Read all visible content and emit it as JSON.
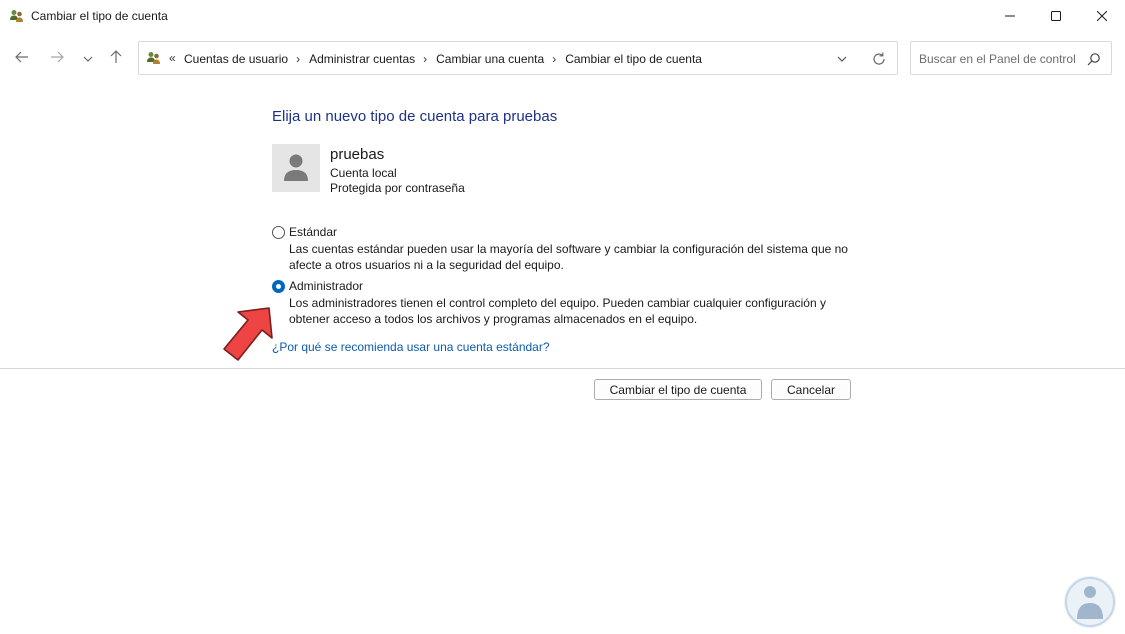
{
  "window": {
    "title": "Cambiar el tipo de cuenta"
  },
  "nav": {
    "breadcrumbs": [
      "Cuentas de usuario",
      "Administrar cuentas",
      "Cambiar una cuenta",
      "Cambiar el tipo de cuenta"
    ],
    "search_placeholder": "Buscar en el Panel de control"
  },
  "main": {
    "heading": "Elija un nuevo tipo de cuenta para pruebas",
    "user": {
      "name": "pruebas",
      "type": "Cuenta local",
      "protection": "Protegida por contraseña"
    },
    "options": [
      {
        "label": "Estándar",
        "description": "Las cuentas estándar pueden usar la mayoría del software y cambiar la configuración del sistema que no afecte a otros usuarios ni a la seguridad del equipo.",
        "selected": false
      },
      {
        "label": "Administrador",
        "description": "Los administradores tienen el control completo del equipo. Pueden cambiar cualquier configuración y obtener acceso a todos los archivos y programas almacenados en el equipo.",
        "selected": true
      }
    ],
    "help_link": "¿Por qué se recomienda usar una cuenta estándar?"
  },
  "footer": {
    "primary_button": "Cambiar el tipo de cuenta",
    "cancel_button": "Cancelar"
  },
  "colors": {
    "heading": "#1e3287",
    "link": "#0b5cad",
    "radio_selected": "#0067c0",
    "annotation_arrow": "#ee4444"
  },
  "icons": [
    "control-panel-icon",
    "minimize-icon",
    "maximize-icon",
    "close-icon",
    "back-arrow-icon",
    "forward-arrow-icon",
    "recent-dropdown-icon",
    "up-arrow-icon",
    "chevron-down-icon",
    "refresh-icon",
    "search-icon",
    "user-avatar-icon",
    "red-arrow-annotation",
    "watermark-logo"
  ]
}
